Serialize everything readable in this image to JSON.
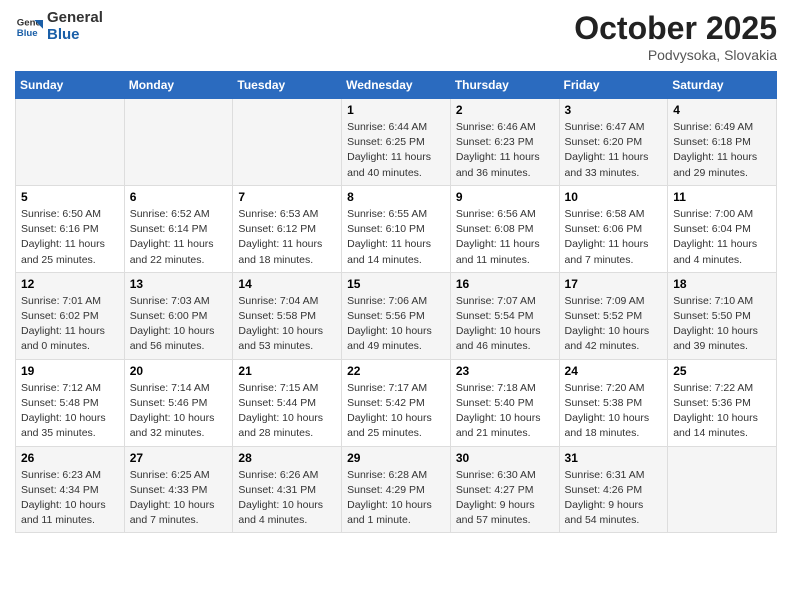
{
  "header": {
    "logo_line1": "General",
    "logo_line2": "Blue",
    "month": "October 2025",
    "location": "Podvysoka, Slovakia"
  },
  "weekdays": [
    "Sunday",
    "Monday",
    "Tuesday",
    "Wednesday",
    "Thursday",
    "Friday",
    "Saturday"
  ],
  "weeks": [
    [
      {
        "day": "",
        "info": ""
      },
      {
        "day": "",
        "info": ""
      },
      {
        "day": "",
        "info": ""
      },
      {
        "day": "1",
        "info": "Sunrise: 6:44 AM\nSunset: 6:25 PM\nDaylight: 11 hours and 40 minutes."
      },
      {
        "day": "2",
        "info": "Sunrise: 6:46 AM\nSunset: 6:23 PM\nDaylight: 11 hours and 36 minutes."
      },
      {
        "day": "3",
        "info": "Sunrise: 6:47 AM\nSunset: 6:20 PM\nDaylight: 11 hours and 33 minutes."
      },
      {
        "day": "4",
        "info": "Sunrise: 6:49 AM\nSunset: 6:18 PM\nDaylight: 11 hours and 29 minutes."
      }
    ],
    [
      {
        "day": "5",
        "info": "Sunrise: 6:50 AM\nSunset: 6:16 PM\nDaylight: 11 hours and 25 minutes."
      },
      {
        "day": "6",
        "info": "Sunrise: 6:52 AM\nSunset: 6:14 PM\nDaylight: 11 hours and 22 minutes."
      },
      {
        "day": "7",
        "info": "Sunrise: 6:53 AM\nSunset: 6:12 PM\nDaylight: 11 hours and 18 minutes."
      },
      {
        "day": "8",
        "info": "Sunrise: 6:55 AM\nSunset: 6:10 PM\nDaylight: 11 hours and 14 minutes."
      },
      {
        "day": "9",
        "info": "Sunrise: 6:56 AM\nSunset: 6:08 PM\nDaylight: 11 hours and 11 minutes."
      },
      {
        "day": "10",
        "info": "Sunrise: 6:58 AM\nSunset: 6:06 PM\nDaylight: 11 hours and 7 minutes."
      },
      {
        "day": "11",
        "info": "Sunrise: 7:00 AM\nSunset: 6:04 PM\nDaylight: 11 hours and 4 minutes."
      }
    ],
    [
      {
        "day": "12",
        "info": "Sunrise: 7:01 AM\nSunset: 6:02 PM\nDaylight: 11 hours and 0 minutes."
      },
      {
        "day": "13",
        "info": "Sunrise: 7:03 AM\nSunset: 6:00 PM\nDaylight: 10 hours and 56 minutes."
      },
      {
        "day": "14",
        "info": "Sunrise: 7:04 AM\nSunset: 5:58 PM\nDaylight: 10 hours and 53 minutes."
      },
      {
        "day": "15",
        "info": "Sunrise: 7:06 AM\nSunset: 5:56 PM\nDaylight: 10 hours and 49 minutes."
      },
      {
        "day": "16",
        "info": "Sunrise: 7:07 AM\nSunset: 5:54 PM\nDaylight: 10 hours and 46 minutes."
      },
      {
        "day": "17",
        "info": "Sunrise: 7:09 AM\nSunset: 5:52 PM\nDaylight: 10 hours and 42 minutes."
      },
      {
        "day": "18",
        "info": "Sunrise: 7:10 AM\nSunset: 5:50 PM\nDaylight: 10 hours and 39 minutes."
      }
    ],
    [
      {
        "day": "19",
        "info": "Sunrise: 7:12 AM\nSunset: 5:48 PM\nDaylight: 10 hours and 35 minutes."
      },
      {
        "day": "20",
        "info": "Sunrise: 7:14 AM\nSunset: 5:46 PM\nDaylight: 10 hours and 32 minutes."
      },
      {
        "day": "21",
        "info": "Sunrise: 7:15 AM\nSunset: 5:44 PM\nDaylight: 10 hours and 28 minutes."
      },
      {
        "day": "22",
        "info": "Sunrise: 7:17 AM\nSunset: 5:42 PM\nDaylight: 10 hours and 25 minutes."
      },
      {
        "day": "23",
        "info": "Sunrise: 7:18 AM\nSunset: 5:40 PM\nDaylight: 10 hours and 21 minutes."
      },
      {
        "day": "24",
        "info": "Sunrise: 7:20 AM\nSunset: 5:38 PM\nDaylight: 10 hours and 18 minutes."
      },
      {
        "day": "25",
        "info": "Sunrise: 7:22 AM\nSunset: 5:36 PM\nDaylight: 10 hours and 14 minutes."
      }
    ],
    [
      {
        "day": "26",
        "info": "Sunrise: 6:23 AM\nSunset: 4:34 PM\nDaylight: 10 hours and 11 minutes."
      },
      {
        "day": "27",
        "info": "Sunrise: 6:25 AM\nSunset: 4:33 PM\nDaylight: 10 hours and 7 minutes."
      },
      {
        "day": "28",
        "info": "Sunrise: 6:26 AM\nSunset: 4:31 PM\nDaylight: 10 hours and 4 minutes."
      },
      {
        "day": "29",
        "info": "Sunrise: 6:28 AM\nSunset: 4:29 PM\nDaylight: 10 hours and 1 minute."
      },
      {
        "day": "30",
        "info": "Sunrise: 6:30 AM\nSunset: 4:27 PM\nDaylight: 9 hours and 57 minutes."
      },
      {
        "day": "31",
        "info": "Sunrise: 6:31 AM\nSunset: 4:26 PM\nDaylight: 9 hours and 54 minutes."
      },
      {
        "day": "",
        "info": ""
      }
    ]
  ]
}
